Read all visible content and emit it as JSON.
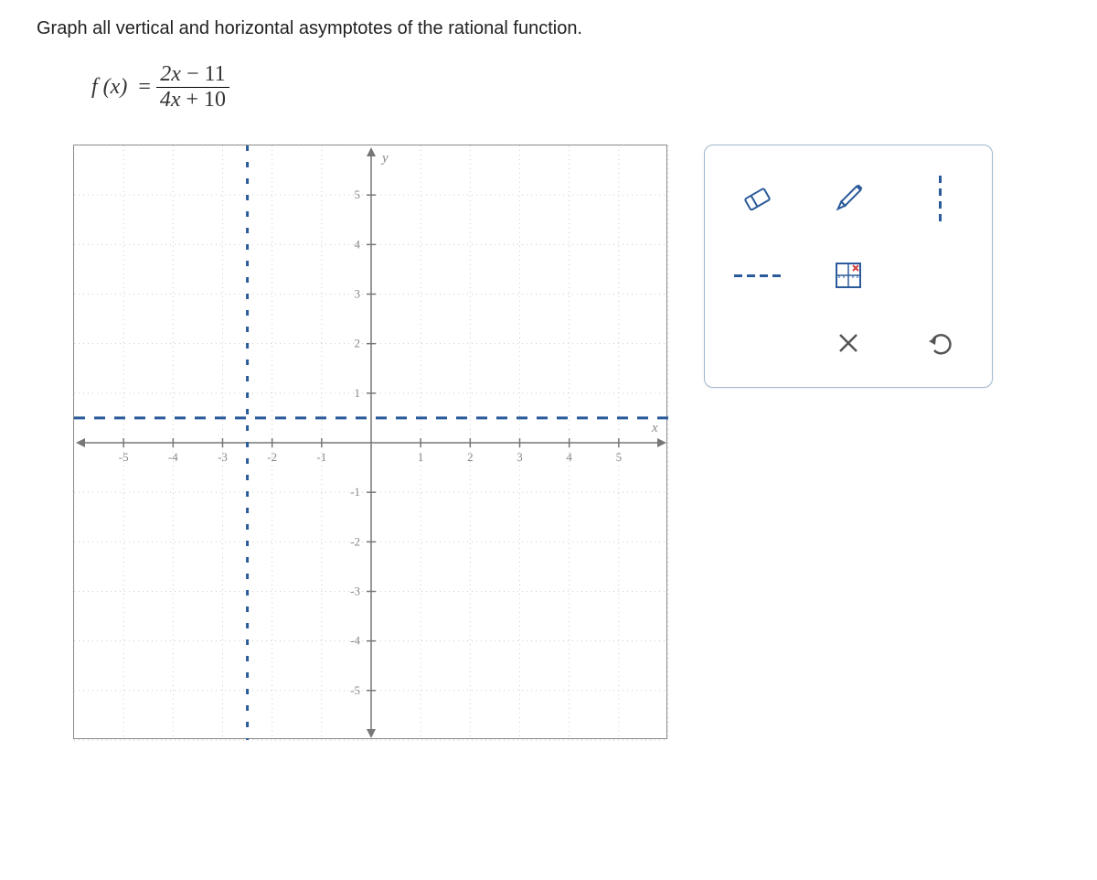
{
  "instruction": "Graph all vertical and horizontal asymptotes of the rational function.",
  "function": {
    "label": "f (x)",
    "equals": "=",
    "numerator_var": "2x",
    "numerator_const": "− 11",
    "denominator_var": "4x",
    "denominator_const": "+ 10"
  },
  "chart_data": {
    "type": "scatter",
    "title": "",
    "xlabel": "x",
    "ylabel": "y",
    "xlim": [
      -6,
      6
    ],
    "ylim": [
      -6,
      6
    ],
    "x_ticks": [
      "-5",
      "-4",
      "-3",
      "-2",
      "-1",
      "1",
      "2",
      "3",
      "4",
      "5"
    ],
    "y_ticks": [
      "5",
      "4",
      "3",
      "2",
      "1",
      "-1",
      "-2",
      "-3",
      "-4",
      "-5"
    ],
    "vertical_asymptote": -2.5,
    "horizontal_asymptote": 0.5
  }
}
